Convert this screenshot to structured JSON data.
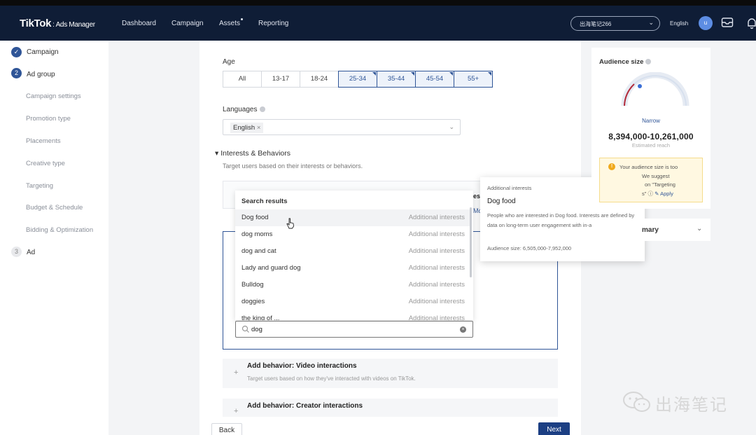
{
  "header": {
    "logo": "TikTok",
    "logo_sub": "Ads Manager",
    "nav": [
      "Dashboard",
      "Campaign",
      "Assets",
      "Reporting"
    ],
    "account": "出海笔记266",
    "language": "English",
    "avatar_initial": "u"
  },
  "sidebar": {
    "steps": [
      {
        "num": "✓",
        "label": "Campaign"
      },
      {
        "num": "2",
        "label": "Ad group"
      },
      {
        "num": "3",
        "label": "Ad"
      }
    ],
    "sub_items": [
      "Campaign settings",
      "Promotion type",
      "Placements",
      "Creative type",
      "Targeting",
      "Budget & Schedule",
      "Bidding & Optimization"
    ]
  },
  "age": {
    "label": "Age",
    "options": [
      {
        "label": "All",
        "selected": false
      },
      {
        "label": "13-17",
        "selected": false
      },
      {
        "label": "18-24",
        "selected": false
      },
      {
        "label": "25-34",
        "selected": true
      },
      {
        "label": "35-44",
        "selected": true
      },
      {
        "label": "45-54",
        "selected": true
      },
      {
        "label": "55+",
        "selected": true
      }
    ]
  },
  "languages": {
    "label": "Languages",
    "tag": "English"
  },
  "interests": {
    "title": "Interests & Behaviors",
    "desc": "Target users based on their interests or behaviors.",
    "partial_header": "es",
    "partial_link": "Mo"
  },
  "dropdown": {
    "header": "Search results",
    "rows": [
      {
        "name": "Dog food",
        "type": "Additional interests"
      },
      {
        "name": "dog moms",
        "type": "Additional interests"
      },
      {
        "name": "dog and cat",
        "type": "Additional interests"
      },
      {
        "name": "Lady and guard dog",
        "type": "Additional interests"
      },
      {
        "name": "Bulldog",
        "type": "Additional interests"
      },
      {
        "name": "doggies",
        "type": "Additional interests"
      },
      {
        "name": "the king of ...",
        "type": "Additional interests"
      }
    ]
  },
  "search": {
    "value": "dog"
  },
  "tooltip": {
    "category": "Additional interests",
    "title": "Dog food",
    "desc": "People who are interested in Dog food. Interests are defined by data on long-term user engagement with in-app content",
    "size": "Audience size: 6,505,000-7,952,000"
  },
  "behaviors": [
    {
      "title": "Add behavior: Video interactions",
      "desc": "Target users based on how they've interacted with videos on TikTok."
    },
    {
      "title": "Add behavior: Creator interactions",
      "desc": ""
    }
  ],
  "buttons": {
    "back": "Back",
    "next": "Next"
  },
  "audience": {
    "title": "Audience size",
    "level": "Narrow",
    "range": "8,394,000-10,261,000",
    "sub": "Estimated reach",
    "warn_lines": [
      "Your audience size is too",
      "We suggest",
      "on \"Targeting",
      "s\""
    ],
    "apply": "Apply"
  },
  "summary": {
    "label": "mary"
  },
  "watermark": "出海笔记",
  "colors": {
    "nav_bg": "#0f1d36",
    "accent": "#2f5597",
    "next_btn": "#1c3f83",
    "warn_bg": "#fff8e1"
  }
}
